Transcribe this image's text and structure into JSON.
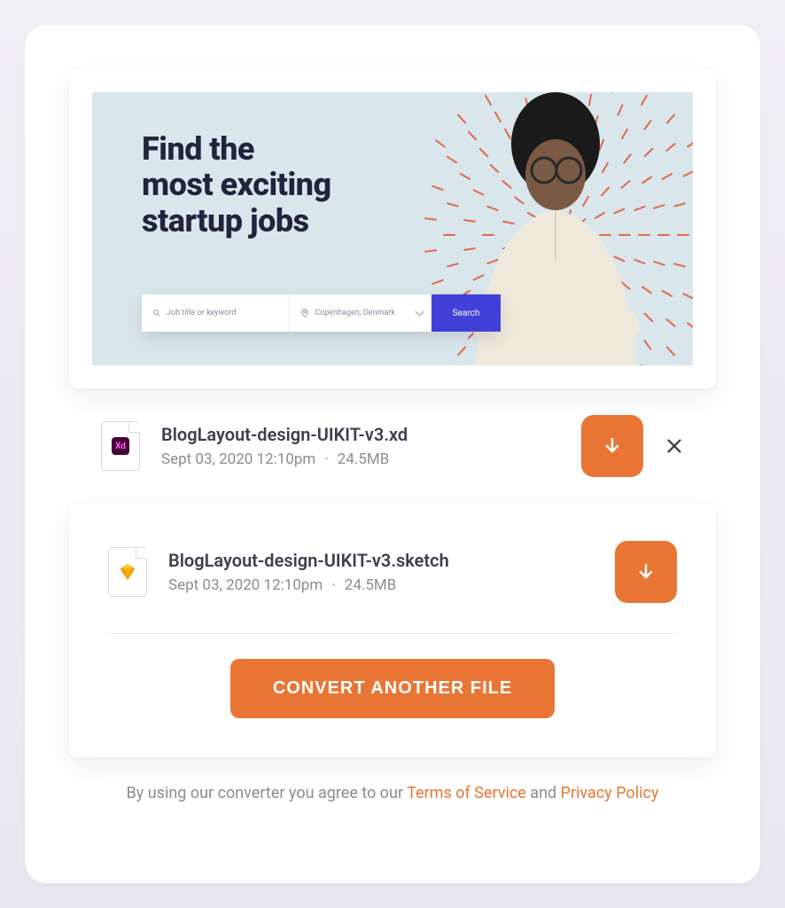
{
  "colors": {
    "accent": "#e97534",
    "search_button": "#4040d9"
  },
  "preview": {
    "heading_line1": "Find the",
    "heading_line2": "most exciting",
    "heading_line3": "startup jobs",
    "search": {
      "keyword_placeholder": "Job title or keyword",
      "location_value": "Copenhagen, Denmark",
      "button_label": "Search"
    }
  },
  "files": [
    {
      "icon": "xd",
      "name": "BlogLayout-design-UIKIT-v3.xd",
      "date": "Sept 03, 2020 12:10pm",
      "size": "24.5MB",
      "dismissable": true
    },
    {
      "icon": "sketch",
      "name": "BlogLayout-design-UIKIT-v3.sketch",
      "date": "Sept 03, 2020 12:10pm",
      "size": "24.5MB",
      "dismissable": false
    }
  ],
  "actions": {
    "convert_another": "CONVERT ANOTHER FILE"
  },
  "legal": {
    "prefix": "By using our converter you agree to our ",
    "tos": "Terms of Service",
    "and": " and ",
    "privacy": "Privacy Policy"
  }
}
